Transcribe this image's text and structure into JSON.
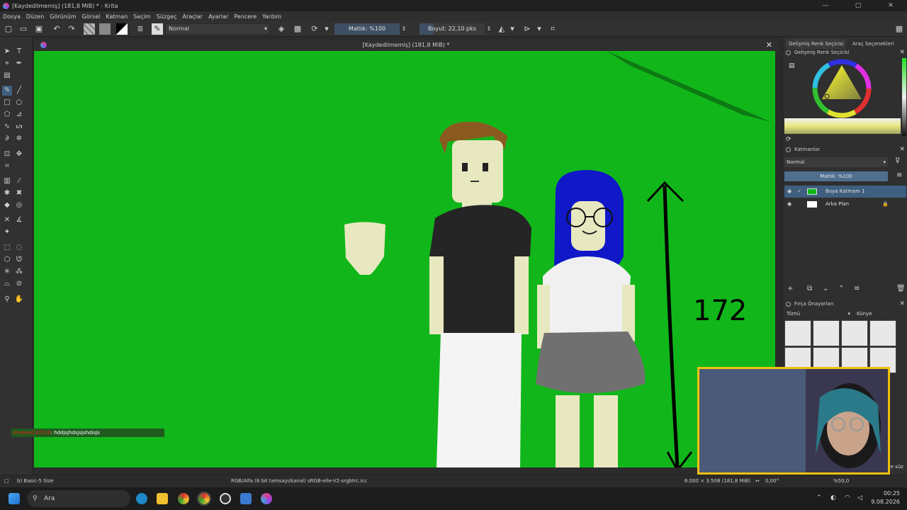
{
  "window": {
    "title": "[Kaydedilmemiş]  (181,8 MiB) * - Krita",
    "controls": [
      "—",
      "▢",
      "✕"
    ]
  },
  "menu": [
    "Dosya",
    "Düzen",
    "Görünüm",
    "Görsel",
    "Katman",
    "Seçim",
    "Süzgeç",
    "Araçlar",
    "Ayarlar",
    "Pencere",
    "Yardım"
  ],
  "toolbar": {
    "blend_mode": "Normal",
    "opacity": "Matlık: %100",
    "size": "Boyut: 22,10 pks"
  },
  "document": {
    "tab_title": "[Kaydedilmemiş]  (181,8 MiB) *"
  },
  "canvas": {
    "annotation_number": "172",
    "bg_color": "#11b71a"
  },
  "chat": {
    "user": "shadow232526",
    "message": ": hddjsjhdsjsjshdisjs"
  },
  "right_panel": {
    "tabs": [
      "Gelişmiş Renk Seçicisi",
      "Araç Seçenekleri"
    ],
    "color_dock_title": "Gelişmiş Renk Seçicisi",
    "layers_dock_title": "Katmanlar",
    "layers_blend": "Normal",
    "layers_opacity": "Matlık: %100",
    "layers": [
      {
        "name": "Boya Katmanı 1"
      },
      {
        "name": "Arka Plan"
      }
    ],
    "brush_dock_title": "Fırça Önayarları",
    "brush_filter": "Tümü",
    "brush_tag": "Künye",
    "brush_search_suffix": "ze süz"
  },
  "status": {
    "brush": "b) Basic-5 Size",
    "color_profile": "RGB/Alfa (8 bit tamsayı/kanal)  sRGB-elle-V2-srgbtrc.icc",
    "dimensions": "6.000 × 3.508 (181,8 MiB)",
    "rotation": "0,00°",
    "zoom": "%50,0"
  },
  "taskbar": {
    "search_placeholder": "Ara",
    "time": "00:25",
    "date": "9.08.2026"
  }
}
